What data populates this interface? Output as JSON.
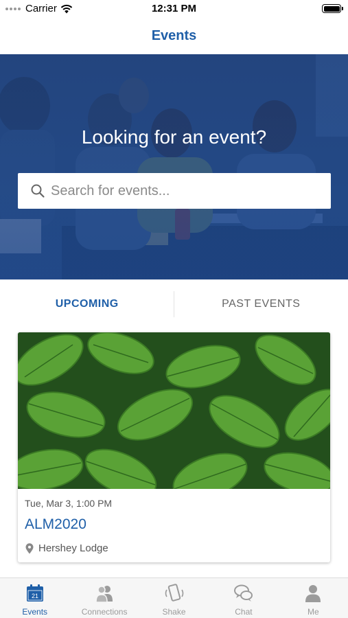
{
  "status_bar": {
    "carrier": "Carrier",
    "time": "12:31 PM"
  },
  "nav": {
    "title": "Events"
  },
  "hero": {
    "title": "Looking for an event?",
    "search_placeholder": "Search for events..."
  },
  "tabs": [
    {
      "label": "UPCOMING",
      "active": true
    },
    {
      "label": "PAST EVENTS",
      "active": false
    }
  ],
  "event": {
    "date": "Tue, Mar 3, 1:00 PM",
    "title": "ALM2020",
    "location": "Hershey Lodge"
  },
  "tab_bar": {
    "items": [
      {
        "label": "Events",
        "icon": "calendar-icon",
        "badge": "21",
        "active": true
      },
      {
        "label": "Connections",
        "icon": "people-icon",
        "active": false
      },
      {
        "label": "Shake",
        "icon": "phone-shake-icon",
        "active": false
      },
      {
        "label": "Chat",
        "icon": "chat-bubbles-icon",
        "active": false
      },
      {
        "label": "Me",
        "icon": "person-icon",
        "active": false
      }
    ]
  },
  "colors": {
    "accent": "#1f5fa8",
    "hero_overlay": "#1e4a8c",
    "inactive": "#9b9b9b"
  }
}
